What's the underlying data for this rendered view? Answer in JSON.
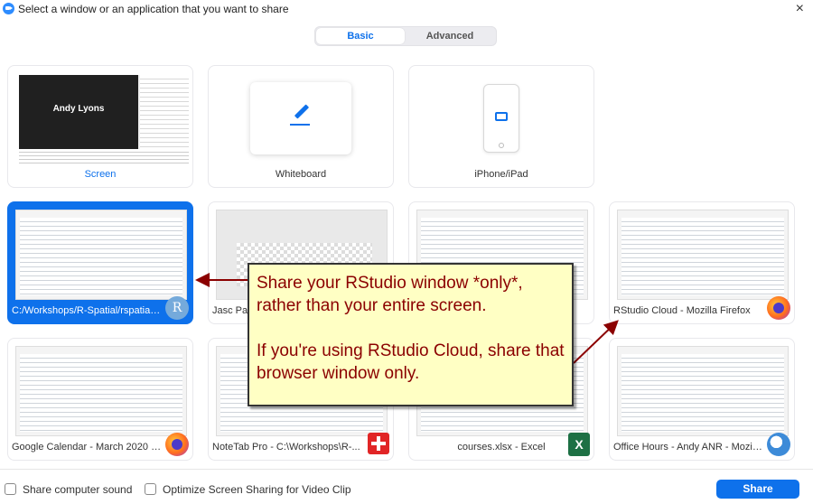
{
  "window": {
    "title": "Select a window or an application that you want to share",
    "close_glyph": "×"
  },
  "tabs": [
    {
      "label": "Basic",
      "selected": true
    },
    {
      "label": "Advanced",
      "selected": false
    }
  ],
  "tiles": [
    {
      "label": "Screen",
      "thumb_text": "Andy Lyons"
    },
    {
      "label": "Whiteboard",
      "icon": "pencil-icon"
    },
    {
      "label": "iPhone/iPad",
      "icon": "airplay-icon"
    },
    {
      "label": "C:/Workshops/R-Spatial/rspatial_...",
      "icon": "rstudio-icon",
      "icon_text": "R",
      "selected": true
    },
    {
      "label": "Jasc Pai",
      "icon": "jasc-paint-icon"
    },
    {
      "label": "",
      "icon": "explorer-window"
    },
    {
      "label": "RStudio Cloud - Mozilla Firefox",
      "icon": "firefox-icon"
    },
    {
      "label": "Google Calendar - March 2020 - ...",
      "icon": "firefox-icon"
    },
    {
      "label": "NoteTab Pro  - C:\\Workshops\\R-...",
      "icon": "notetab-icon"
    },
    {
      "label": "courses.xlsx - Excel",
      "icon": "excel-icon",
      "icon_text": "X"
    },
    {
      "label": "Office Hours - Andy ANR - Mozill...",
      "icon": "thunderbird-icon"
    }
  ],
  "callout": {
    "line1": "Share your RStudio window *only*,",
    "line2": "rather than your entire screen.",
    "line3": "If you're using RStudio Cloud, share that",
    "line4": "browser window only.",
    "color": "#8b0000"
  },
  "footer": {
    "share_sound": "Share computer sound",
    "optimize": "Optimize Screen Sharing for Video Clip",
    "share_button": "Share"
  },
  "colors": {
    "accent": "#0e71eb",
    "callout_bg": "#ffffc4"
  }
}
